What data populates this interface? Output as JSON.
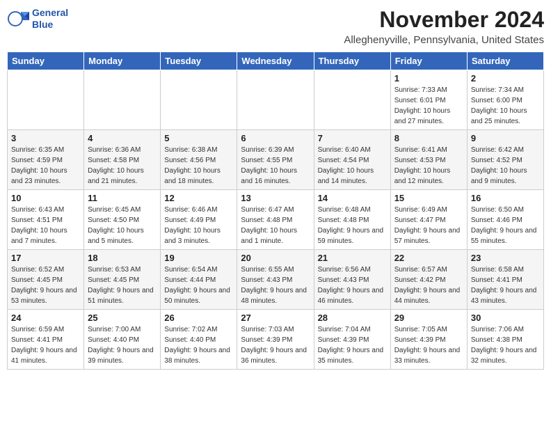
{
  "header": {
    "logo_line1": "General",
    "logo_line2": "Blue",
    "month": "November 2024",
    "location": "Alleghenyville, Pennsylvania, United States"
  },
  "days_of_week": [
    "Sunday",
    "Monday",
    "Tuesday",
    "Wednesday",
    "Thursday",
    "Friday",
    "Saturday"
  ],
  "weeks": [
    [
      {
        "day": "",
        "detail": ""
      },
      {
        "day": "",
        "detail": ""
      },
      {
        "day": "",
        "detail": ""
      },
      {
        "day": "",
        "detail": ""
      },
      {
        "day": "",
        "detail": ""
      },
      {
        "day": "1",
        "detail": "Sunrise: 7:33 AM\nSunset: 6:01 PM\nDaylight: 10 hours and 27 minutes."
      },
      {
        "day": "2",
        "detail": "Sunrise: 7:34 AM\nSunset: 6:00 PM\nDaylight: 10 hours and 25 minutes."
      }
    ],
    [
      {
        "day": "3",
        "detail": "Sunrise: 6:35 AM\nSunset: 4:59 PM\nDaylight: 10 hours and 23 minutes."
      },
      {
        "day": "4",
        "detail": "Sunrise: 6:36 AM\nSunset: 4:58 PM\nDaylight: 10 hours and 21 minutes."
      },
      {
        "day": "5",
        "detail": "Sunrise: 6:38 AM\nSunset: 4:56 PM\nDaylight: 10 hours and 18 minutes."
      },
      {
        "day": "6",
        "detail": "Sunrise: 6:39 AM\nSunset: 4:55 PM\nDaylight: 10 hours and 16 minutes."
      },
      {
        "day": "7",
        "detail": "Sunrise: 6:40 AM\nSunset: 4:54 PM\nDaylight: 10 hours and 14 minutes."
      },
      {
        "day": "8",
        "detail": "Sunrise: 6:41 AM\nSunset: 4:53 PM\nDaylight: 10 hours and 12 minutes."
      },
      {
        "day": "9",
        "detail": "Sunrise: 6:42 AM\nSunset: 4:52 PM\nDaylight: 10 hours and 9 minutes."
      }
    ],
    [
      {
        "day": "10",
        "detail": "Sunrise: 6:43 AM\nSunset: 4:51 PM\nDaylight: 10 hours and 7 minutes."
      },
      {
        "day": "11",
        "detail": "Sunrise: 6:45 AM\nSunset: 4:50 PM\nDaylight: 10 hours and 5 minutes."
      },
      {
        "day": "12",
        "detail": "Sunrise: 6:46 AM\nSunset: 4:49 PM\nDaylight: 10 hours and 3 minutes."
      },
      {
        "day": "13",
        "detail": "Sunrise: 6:47 AM\nSunset: 4:48 PM\nDaylight: 10 hours and 1 minute."
      },
      {
        "day": "14",
        "detail": "Sunrise: 6:48 AM\nSunset: 4:48 PM\nDaylight: 9 hours and 59 minutes."
      },
      {
        "day": "15",
        "detail": "Sunrise: 6:49 AM\nSunset: 4:47 PM\nDaylight: 9 hours and 57 minutes."
      },
      {
        "day": "16",
        "detail": "Sunrise: 6:50 AM\nSunset: 4:46 PM\nDaylight: 9 hours and 55 minutes."
      }
    ],
    [
      {
        "day": "17",
        "detail": "Sunrise: 6:52 AM\nSunset: 4:45 PM\nDaylight: 9 hours and 53 minutes."
      },
      {
        "day": "18",
        "detail": "Sunrise: 6:53 AM\nSunset: 4:45 PM\nDaylight: 9 hours and 51 minutes."
      },
      {
        "day": "19",
        "detail": "Sunrise: 6:54 AM\nSunset: 4:44 PM\nDaylight: 9 hours and 50 minutes."
      },
      {
        "day": "20",
        "detail": "Sunrise: 6:55 AM\nSunset: 4:43 PM\nDaylight: 9 hours and 48 minutes."
      },
      {
        "day": "21",
        "detail": "Sunrise: 6:56 AM\nSunset: 4:43 PM\nDaylight: 9 hours and 46 minutes."
      },
      {
        "day": "22",
        "detail": "Sunrise: 6:57 AM\nSunset: 4:42 PM\nDaylight: 9 hours and 44 minutes."
      },
      {
        "day": "23",
        "detail": "Sunrise: 6:58 AM\nSunset: 4:41 PM\nDaylight: 9 hours and 43 minutes."
      }
    ],
    [
      {
        "day": "24",
        "detail": "Sunrise: 6:59 AM\nSunset: 4:41 PM\nDaylight: 9 hours and 41 minutes."
      },
      {
        "day": "25",
        "detail": "Sunrise: 7:00 AM\nSunset: 4:40 PM\nDaylight: 9 hours and 39 minutes."
      },
      {
        "day": "26",
        "detail": "Sunrise: 7:02 AM\nSunset: 4:40 PM\nDaylight: 9 hours and 38 minutes."
      },
      {
        "day": "27",
        "detail": "Sunrise: 7:03 AM\nSunset: 4:39 PM\nDaylight: 9 hours and 36 minutes."
      },
      {
        "day": "28",
        "detail": "Sunrise: 7:04 AM\nSunset: 4:39 PM\nDaylight: 9 hours and 35 minutes."
      },
      {
        "day": "29",
        "detail": "Sunrise: 7:05 AM\nSunset: 4:39 PM\nDaylight: 9 hours and 33 minutes."
      },
      {
        "day": "30",
        "detail": "Sunrise: 7:06 AM\nSunset: 4:38 PM\nDaylight: 9 hours and 32 minutes."
      }
    ]
  ]
}
